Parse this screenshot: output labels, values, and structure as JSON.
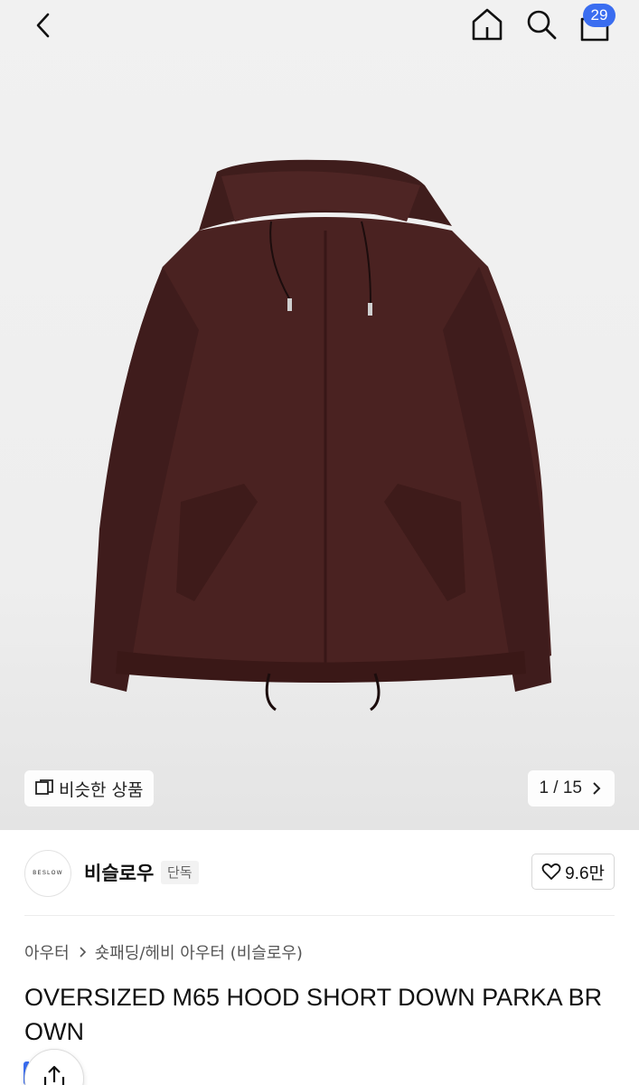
{
  "topbar": {
    "back_icon": "chevron-left-icon",
    "home_icon": "home-icon",
    "search_icon": "search-icon",
    "cart_icon": "shopping-bag-icon",
    "cart_count": "29",
    "badge_color": "#3a6df0"
  },
  "gallery": {
    "similar_label": "비슷한 상품",
    "similar_icon": "overlap-squares-icon",
    "pager_text": "1 / 15",
    "pager_icon": "chevron-right-icon"
  },
  "brand": {
    "logo_text": "BESLOW",
    "name": "비슬로우",
    "tag": "단독",
    "likes": "9.6만",
    "like_icon": "heart-icon"
  },
  "breadcrumb": {
    "level1": "아우터",
    "level2": "숏패딩/헤비 아우터 (비슬로우)"
  },
  "product": {
    "title": "OVERSIZED M65 HOOD SHORT DOWN PARKA BROWN",
    "jacket_color": "#4a2221"
  },
  "share": {
    "icon": "share-icon"
  }
}
